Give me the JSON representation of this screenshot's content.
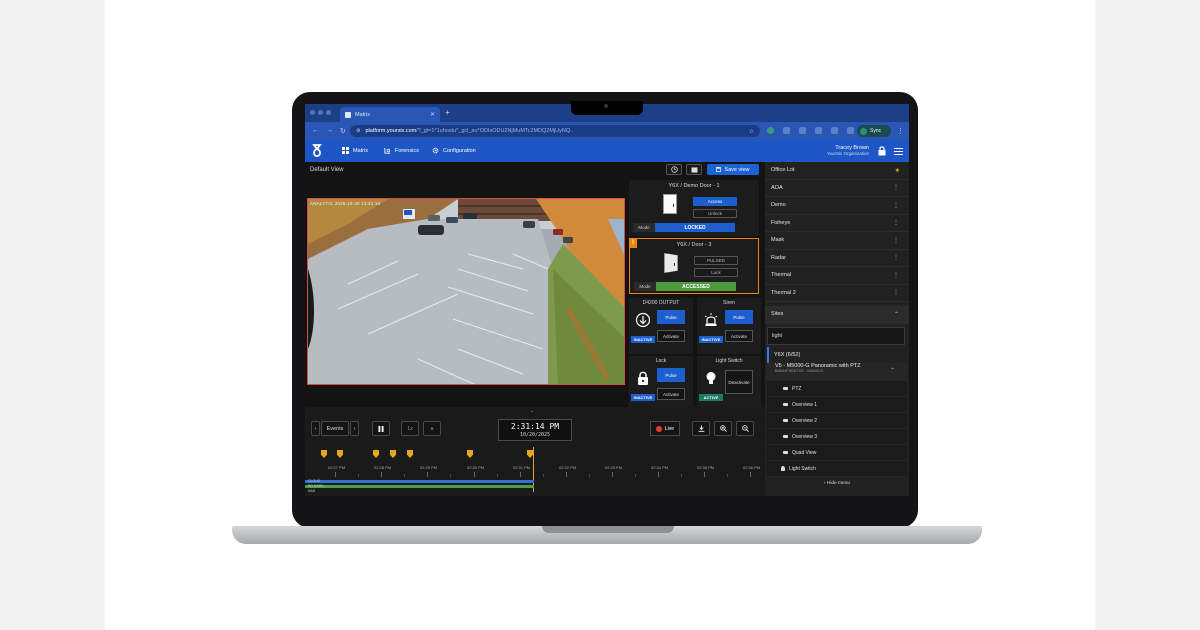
{
  "browser": {
    "tab_title": "Matrix",
    "url_host": "platform.yoursix.com",
    "url_rest": "/?_gl=1*1uhostu*_gcl_au*ODIxODU2NjMuMTc2MDQ2MjUyNQ..",
    "profile_label": "Sync"
  },
  "header": {
    "nav": [
      {
        "label": "Matrix",
        "icon": "grid-icon"
      },
      {
        "label": "Forensics",
        "icon": "forensics-icon"
      },
      {
        "label": "Configuration",
        "icon": "gear-icon"
      }
    ],
    "user_name": "Tracey Brown",
    "user_org": "YourSix Organization"
  },
  "toolbar": {
    "view_name": "Default View",
    "save_label": "Save view"
  },
  "video": {
    "timestamp": "ANALYTIC 2025-10-20 13:31:14"
  },
  "doors": [
    {
      "title": "Y6X / Demo Door - 1",
      "btn1": "Access",
      "btn2": "Unlock",
      "mode_label": "Mode",
      "state": "LOCKED"
    },
    {
      "title": "Y6X / Door - 3",
      "btn1": "PULSED",
      "btn2": "Lock",
      "mode_label": "Mode",
      "state": "ACCESSED",
      "alert": "!"
    }
  ],
  "io": [
    {
      "title": "D4200 OUTPUT",
      "icon": "arrow-down-circle-icon",
      "pulse": "Pulse",
      "activate": "Activate",
      "state": "INACTIVE"
    },
    {
      "title": "Siren",
      "icon": "siren-icon",
      "pulse": "Pulse",
      "activate": "Activate",
      "state": "INACTIVE"
    },
    {
      "title": "Lock",
      "icon": "padlock-icon",
      "pulse": "Pulse",
      "activate": "Activate",
      "state": "INACTIVE"
    },
    {
      "title": "Light Switch",
      "icon": "bulb-icon",
      "deactivate": "Deactivate",
      "state": "ACTIVE"
    }
  ],
  "timeline": {
    "events_label": "Events",
    "speed": "1x",
    "time": "2:31:14 PM",
    "date": "10/20/2025",
    "live_label": "Live",
    "ticks": [
      "02:27 PM",
      "02:28 PM",
      "02:29 PM",
      "02:30 PM",
      "02:31 PM",
      "02:32 PM",
      "02:33 PM",
      "02:34 PM",
      "02:35 PM",
      "02:36 PM"
    ],
    "tracks": [
      {
        "label": "CLOUD",
        "color": "#2f6fd6"
      },
      {
        "label": "SD CARD",
        "color": "#4aa042"
      },
      {
        "label": "NAS",
        "color": "#555555"
      }
    ]
  },
  "sidebar": {
    "views": [
      "Office Lot",
      "AOA",
      "Demo",
      "Fisheye",
      "Mask",
      "Radar",
      "Thermal",
      "Thermal 2"
    ],
    "sites_label": "Sites",
    "search_value": "light",
    "site_group": "Y6X (6/52)",
    "camera_name": "V5 - M5000-G Panoramic with PTZ",
    "camera_sub": "B8A44F9DDTCE - M5000-G",
    "camera_views": [
      "PTZ",
      "Overview 1",
      "Overview 2",
      "Overview 3",
      "Quad View"
    ],
    "device": "Light Switch",
    "hide_menu": "Hide menu"
  },
  "colors": {
    "accent": "#1e56c6",
    "alert": "#e8870c",
    "accessed": "#4d9a3f"
  }
}
